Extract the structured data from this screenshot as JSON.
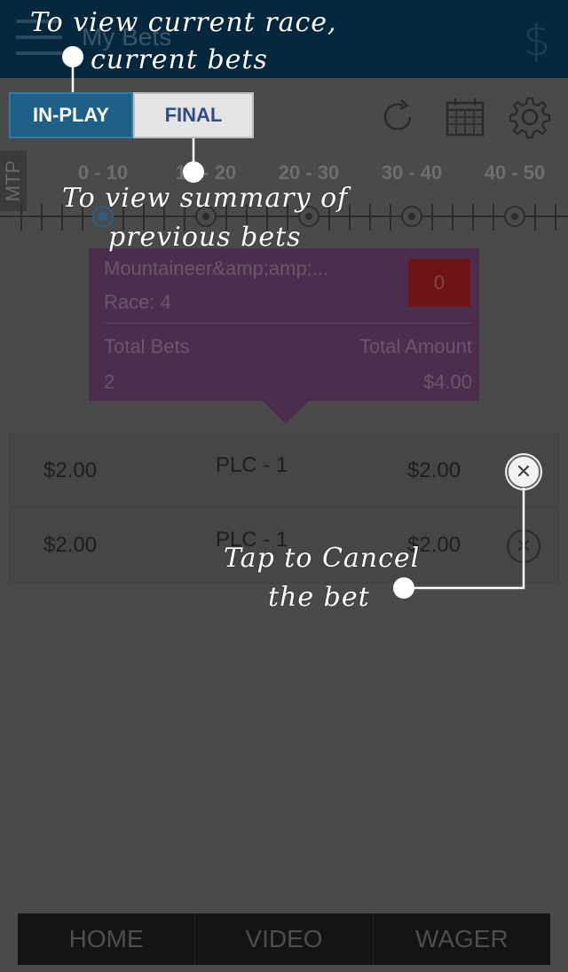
{
  "app": {
    "title": "My Bets",
    "menu_icon": "hamburger-menu-icon",
    "balance_icon": "dollar-icon"
  },
  "tabs": {
    "inplay_label": "IN-PLAY",
    "final_label": "FINAL"
  },
  "toolbar": {
    "icons": [
      "refresh-icon",
      "calendar-icon",
      "gear-icon"
    ]
  },
  "timeline": {
    "mtp_label": "MTP",
    "ranges": [
      "0 - 10",
      "10 - 20",
      "20 - 30",
      "30 - 40",
      "40 - 50"
    ]
  },
  "summary": {
    "venue": "Mountaineer&amp;amp;...",
    "race": "Race: 4",
    "count_badge": "0",
    "total_bets_label": "Total Bets",
    "total_amount_label": "Total Amount",
    "total_bets_value": "2",
    "total_amount_value": "$4.00"
  },
  "bets": [
    {
      "amount": "$2.00",
      "type": "PLC - 1",
      "payout": "$2.00"
    },
    {
      "amount": "$2.00",
      "type": "PLC - 1",
      "payout": "$2.00"
    }
  ],
  "bottom_nav": [
    "HOME",
    "VIDEO",
    "WAGER"
  ],
  "coach_marks": {
    "current_line1": "To view current race,",
    "current_line2": "current bets",
    "summary_line1": "To view summary of",
    "summary_line2": "previous bets",
    "cancel_line1": "Tap to Cancel",
    "cancel_line2": "the bet"
  },
  "colors": {
    "app_bar": "#05283f",
    "inplay_tab": "#1d5f86",
    "final_tab": "#e4e4e4",
    "summary_card": "#4b2d4e",
    "badge": "#6e1414",
    "overlay_text": "#ffffff"
  }
}
